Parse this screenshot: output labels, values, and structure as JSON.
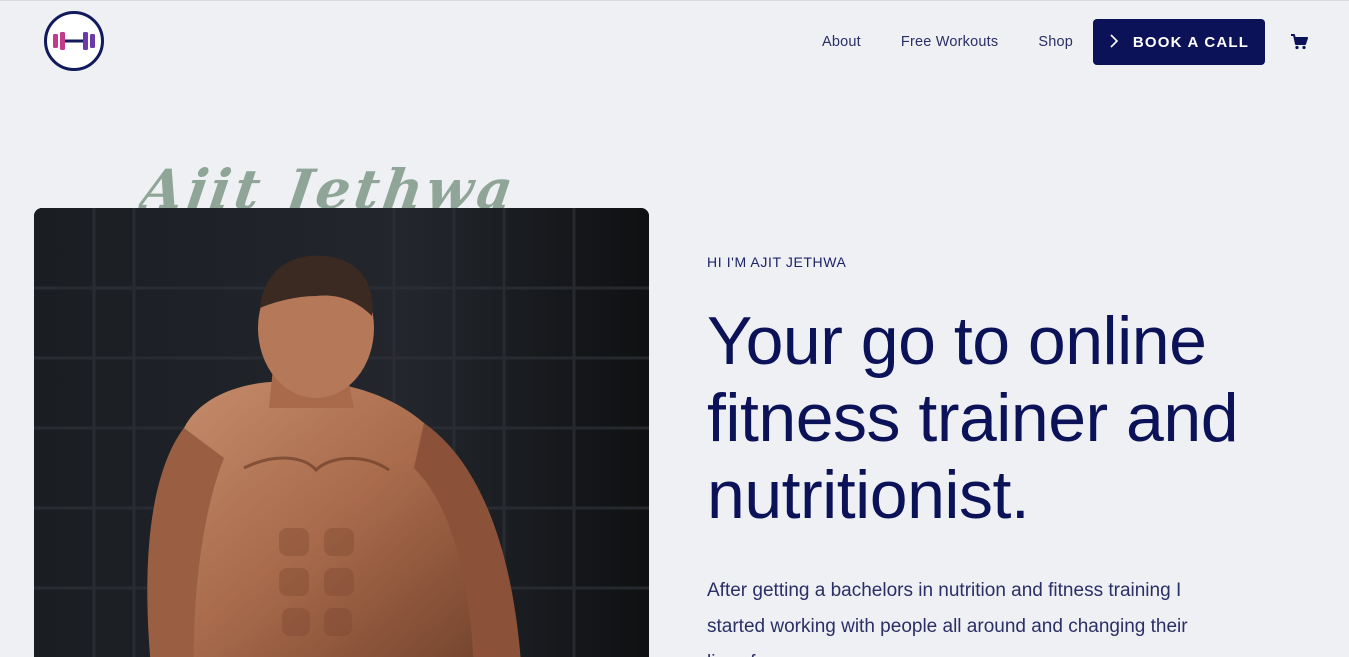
{
  "header": {
    "nav": [
      "About",
      "Free Workouts",
      "Shop"
    ],
    "book_label": "BOOK A CALL",
    "colors": {
      "brand": "#0b1258",
      "accent_pink": "#c23a8a",
      "accent_purple": "#6b3aa8"
    }
  },
  "hero": {
    "script_name": "Ajit Jethwa",
    "eyebrow": "HI I'M AJIT JETHWA",
    "headline": "Your go to online fitness trainer and nutritionist.",
    "paragraph": "After getting a bachelors in nutrition and fitness training I started working with people all around and changing their lives forever.",
    "photo_icon": "trainer-photo"
  },
  "icons": {
    "logo": "dumbbell-logo-icon",
    "cart": "cart-icon",
    "book_chevron": "chevron-right-icon"
  }
}
